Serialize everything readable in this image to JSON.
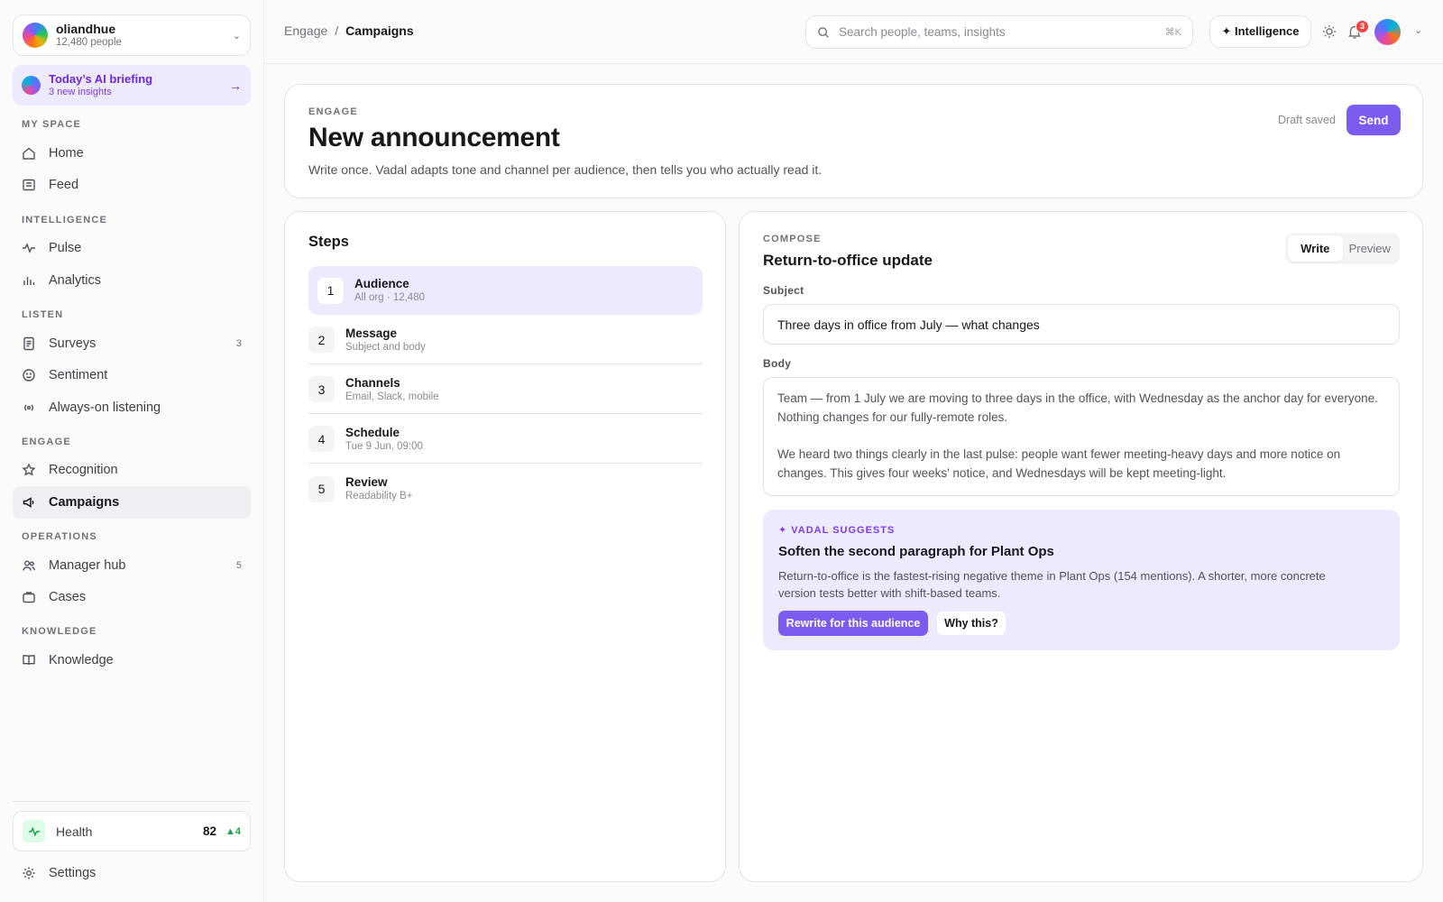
{
  "org": {
    "name": "oliandhue",
    "count": "12,480 people"
  },
  "briefing": {
    "title": "Today’s AI briefing",
    "subtitle": "3 new insights"
  },
  "sidebar": {
    "sections": {
      "my_space": "MY SPACE",
      "intelligence": "INTELLIGENCE",
      "listen": "LISTEN",
      "engage": "ENGAGE",
      "operations": "OPERATIONS",
      "knowledge": "KNOWLEDGE"
    },
    "items": {
      "home": {
        "label": "Home",
        "icon": "home-icon"
      },
      "feed": {
        "label": "Feed",
        "icon": "feed-icon"
      },
      "pulse": {
        "label": "Pulse",
        "icon": "pulse-icon"
      },
      "analytics": {
        "label": "Analytics",
        "icon": "bar-chart-icon"
      },
      "surveys": {
        "label": "Surveys",
        "count": "3",
        "icon": "survey-icon"
      },
      "sentiment": {
        "label": "Sentiment",
        "icon": "smile-icon"
      },
      "listening": {
        "label": "Always-on listening",
        "icon": "broadcast-icon"
      },
      "recognition": {
        "label": "Recognition",
        "icon": "star-icon"
      },
      "campaigns": {
        "label": "Campaigns",
        "icon": "megaphone-icon",
        "active": true
      },
      "manager_hub": {
        "label": "Manager hub",
        "count": "5",
        "icon": "users-icon"
      },
      "cases": {
        "label": "Cases",
        "icon": "briefcase-icon"
      },
      "knowledge": {
        "label": "Knowledge",
        "icon": "book-icon"
      }
    },
    "health": {
      "label": "Health",
      "value": "82",
      "delta": "▲4"
    },
    "settings": {
      "label": "Settings"
    }
  },
  "topbar": {
    "breadcrumb": {
      "parent": "Engage",
      "separator": "/",
      "current": "Campaigns"
    },
    "search": {
      "placeholder": "Search people, teams, insights",
      "shortcut": "⌘K"
    },
    "intelligence_label": "✦ Intelligence",
    "notifications": "3"
  },
  "header": {
    "eyebrow": "ENGAGE",
    "title": "New announcement",
    "description": "Write once. Vadal adapts tone and channel per audience, then tells you who actually read it.",
    "draft_status": "Draft saved",
    "send_label": "Send"
  },
  "steps": {
    "title": "Steps",
    "items": [
      {
        "num": "1",
        "title": "Audience",
        "sub": "All org · 12,480"
      },
      {
        "num": "2",
        "title": "Message",
        "sub": "Subject and body"
      },
      {
        "num": "3",
        "title": "Channels",
        "sub": "Email, Slack, mobile"
      },
      {
        "num": "4",
        "title": "Schedule",
        "sub": "Tue 9 Jun, 09:00"
      },
      {
        "num": "5",
        "title": "Review",
        "sub": "Readability B+"
      }
    ]
  },
  "compose": {
    "eyebrow": "COMPOSE",
    "title": "Return-to-office update",
    "tabs": {
      "write": "Write",
      "preview": "Preview"
    },
    "subject_label": "Subject",
    "subject_value": "Three days in office from July — what changes",
    "body_label": "Body",
    "body_p1": "Team — from 1 July we are moving to three days in the office, with Wednesday as the anchor day for everyone. Nothing changes for our fully-remote roles.",
    "body_p2": "We heard two things clearly in the last pulse: people want fewer meeting-heavy days and more notice on changes. This gives four weeks' notice, and Wednesdays will be kept meeting-light."
  },
  "suggestion": {
    "tag": "✦ VADAL SUGGESTS",
    "title": "Soften the second paragraph for Plant Ops",
    "description": "Return-to-office is the fastest-rising negative theme in Plant Ops (154 mentions). A shorter, more concrete version tests better with shift-based teams.",
    "primary": "Rewrite for this audience",
    "secondary": "Why this?"
  }
}
